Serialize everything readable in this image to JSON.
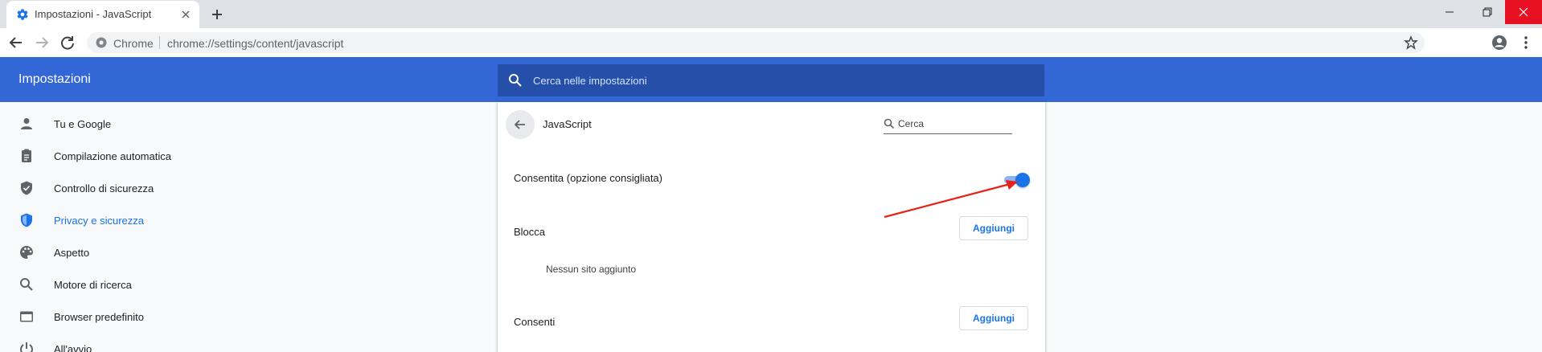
{
  "tab": {
    "title": "Impostazioni - JavaScript"
  },
  "omnibox": {
    "chip": "Chrome",
    "url": "chrome://settings/content/javascript"
  },
  "header": {
    "title": "Impostazioni",
    "search_placeholder": "Cerca nelle impostazioni"
  },
  "sidebar": {
    "items": [
      {
        "label": "Tu e Google",
        "icon": "person-icon"
      },
      {
        "label": "Compilazione automatica",
        "icon": "clipboard-icon"
      },
      {
        "label": "Controllo di sicurezza",
        "icon": "shield-check-icon"
      },
      {
        "label": "Privacy e sicurezza",
        "icon": "shield-icon",
        "active": true
      },
      {
        "label": "Aspetto",
        "icon": "palette-icon"
      },
      {
        "label": "Motore di ricerca",
        "icon": "search-icon"
      },
      {
        "label": "Browser predefinito",
        "icon": "browser-icon"
      },
      {
        "label": "All'avvio",
        "icon": "power-icon"
      }
    ]
  },
  "page": {
    "title": "JavaScript",
    "search_placeholder": "Cerca",
    "allowed_label": "Consentita (opzione consigliata)",
    "allowed_enabled": true,
    "block_label": "Blocca",
    "block_add": "Aggiungi",
    "block_empty": "Nessun sito aggiunto",
    "allow_label": "Consenti",
    "allow_add": "Aggiungi"
  },
  "colors": {
    "header_blue": "#3367d6",
    "search_bar_blue": "#254fa9",
    "accent": "#1a73e8",
    "annotation_red": "#e8211a",
    "close_button_red": "#e81123"
  }
}
